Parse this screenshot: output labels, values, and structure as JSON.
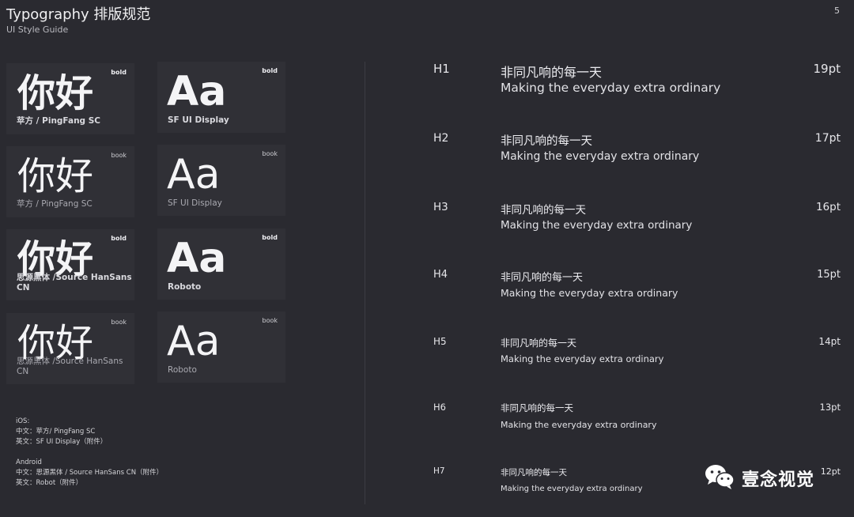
{
  "header": {
    "title": "Typography 排版规范",
    "subtitle": "UI Style Guide",
    "page_number": "5"
  },
  "cards": [
    {
      "glyph": "你好",
      "weight": "bold",
      "name": "苹方 / PingFang SC"
    },
    {
      "glyph": "Aa",
      "weight": "bold",
      "name": "SF UI Display"
    },
    {
      "glyph": "你好",
      "weight": "book",
      "name": "苹方 / PingFang SC"
    },
    {
      "glyph": "Aa",
      "weight": "book",
      "name": "SF UI Display"
    },
    {
      "glyph": "你好",
      "weight": "bold",
      "name": "思源黑体 /Source HanSans CN"
    },
    {
      "glyph": "Aa",
      "weight": "bold",
      "name": "Roboto"
    },
    {
      "glyph": "你好",
      "weight": "book",
      "name": "思源黑体 /Source HanSans CN"
    },
    {
      "glyph": "Aa",
      "weight": "book",
      "name": "Roboto"
    }
  ],
  "notes": {
    "ios": [
      "iOS:",
      "中文：苹方/ PingFang SC",
      "英文：SF UI Display（附件）"
    ],
    "android": [
      "Android",
      "中文：思源黑体  / Source HanSans CN（附件）",
      "英文：Robot（附件）"
    ]
  },
  "headings": [
    {
      "level": "H1",
      "cn": "非同凡响的每一天",
      "en": "Making the everyday extra ordinary",
      "size": "19pt"
    },
    {
      "level": "H2",
      "cn": "非同凡响的每一天",
      "en": "Making the everyday extra ordinary",
      "size": "17pt"
    },
    {
      "level": "H3",
      "cn": "非同凡响的每一天",
      "en": "Making the everyday extra ordinary",
      "size": "16pt"
    },
    {
      "level": "H4",
      "cn": "非同凡响的每一天",
      "en": "Making the everyday extra ordinary",
      "size": "15pt"
    },
    {
      "level": "H5",
      "cn": "非同凡响的每一天",
      "en": "Making the everyday extra ordinary",
      "size": "14pt"
    },
    {
      "level": "H6",
      "cn": "非同凡响的每一天",
      "en": "Making the everyday extra ordinary",
      "size": "13pt"
    },
    {
      "level": "H7",
      "cn": "非同凡响的每一天",
      "en": "Making the everyday extra ordinary",
      "size": "12pt"
    }
  ],
  "watermark": {
    "text": "壹念视觉",
    "icon": "wechat-icon"
  }
}
